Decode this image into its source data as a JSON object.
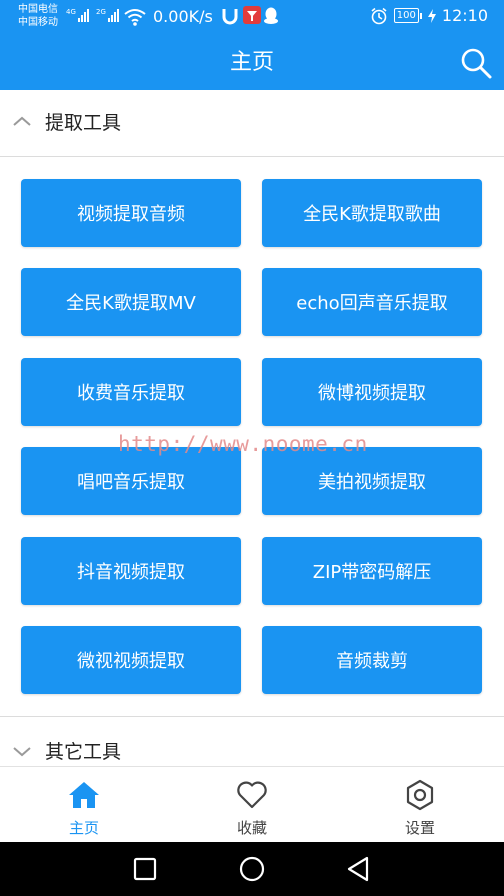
{
  "status_bar": {
    "carrier_1": "中国电信",
    "carrier_2": "中国移动",
    "net_1": "4G",
    "net_2": "2G",
    "speed": "0.00K/s",
    "battery": "100",
    "time": "12:10"
  },
  "app_bar": {
    "title": "主页",
    "search_icon": "search-icon"
  },
  "sections": {
    "extract_tools": {
      "label": "提取工具",
      "expanded": true
    },
    "other_tools": {
      "label": "其它工具",
      "expanded": false
    }
  },
  "tool_buttons": [
    "视频提取音频",
    "全民K歌提取歌曲",
    "全民K歌提取MV",
    "echo回声音乐提取",
    "收费音乐提取",
    "微博视频提取",
    "唱吧音乐提取",
    "美拍视频提取",
    "抖音视频提取",
    "ZIP带密码解压",
    "微视视频提取",
    "音频裁剪"
  ],
  "watermark": "http://www.noome.cn",
  "bottom_nav": [
    {
      "label": "主页",
      "icon": "home-icon",
      "active": true
    },
    {
      "label": "收藏",
      "icon": "heart-icon",
      "active": false
    },
    {
      "label": "设置",
      "icon": "settings-icon",
      "active": false
    }
  ],
  "system_nav": [
    "recent-apps-icon",
    "home-circle-icon",
    "back-triangle-icon"
  ],
  "colors": {
    "primary": "#1a94f2",
    "inactive": "#444444"
  }
}
